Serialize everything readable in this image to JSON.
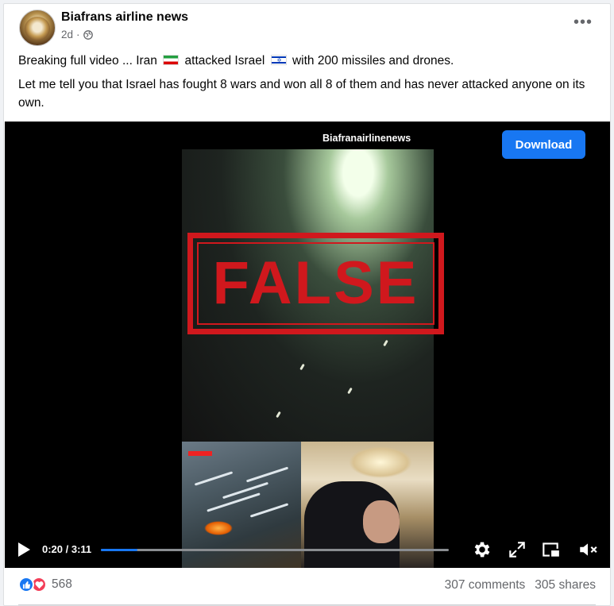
{
  "post": {
    "page_name": "Biafrans airline news",
    "time": "2d",
    "separator": "·",
    "more": "•••",
    "caption_line1_part1": "Breaking full video ... Iran",
    "caption_line1_part2": "attacked Israel",
    "caption_line1_part3": "with 200 missiles and drones.",
    "caption_line2": "Let me tell you that Israel has fought 8 wars and won all 8 of them and has never attacked anyone on its own."
  },
  "video": {
    "watermark": "Biafranairlinenews",
    "download_label": "Download",
    "stamp_text": "FALSE",
    "time_current": "0:20",
    "time_total": "3:11",
    "time_display": "0:20 / 3:11",
    "progress_fraction": 0.105
  },
  "footer": {
    "reaction_count": "568",
    "comments": "307 comments",
    "shares": "305 shares"
  },
  "colors": {
    "accent": "#1877f2",
    "stamp_red": "#d0181d",
    "love": "#f33e58",
    "muted": "#65676b"
  }
}
